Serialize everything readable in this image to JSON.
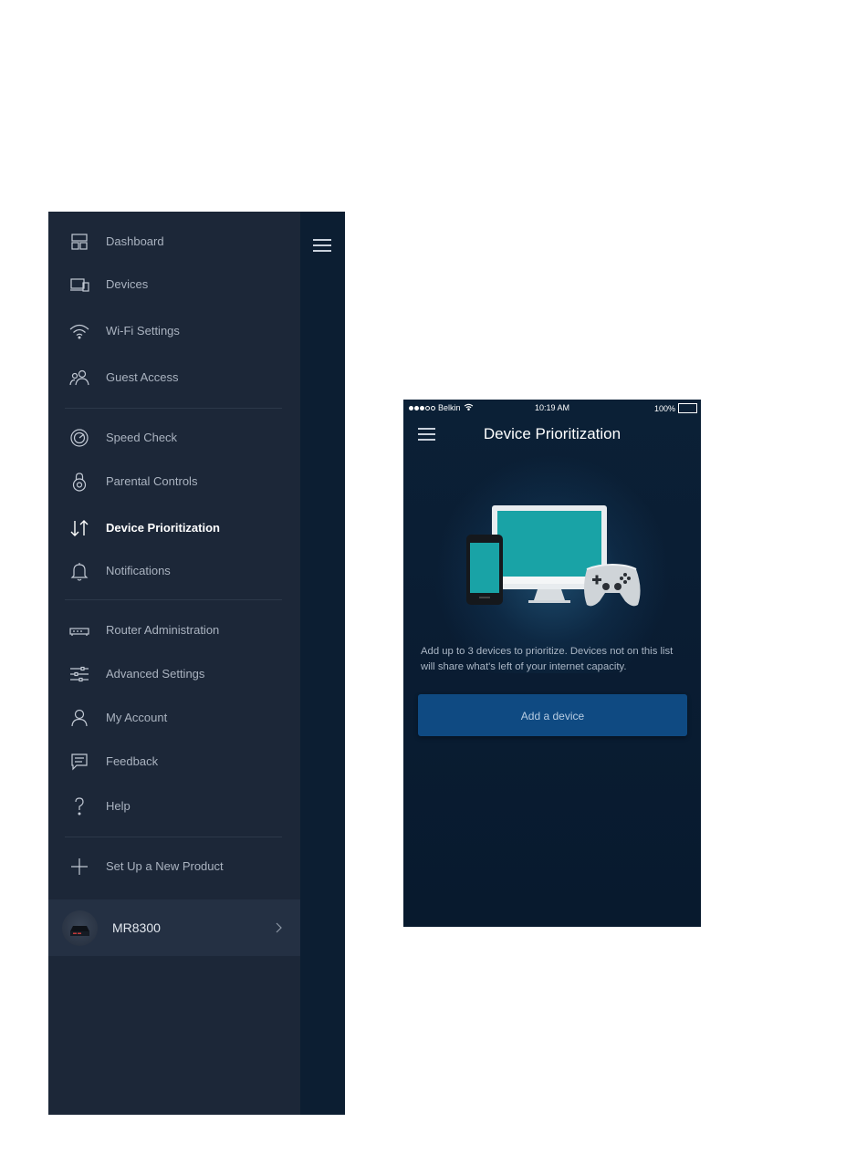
{
  "menu": {
    "items": [
      {
        "label": "Dashboard",
        "icon": "dashboard-icon"
      },
      {
        "label": "Devices",
        "icon": "devices-icon"
      },
      {
        "label": "Wi-Fi Settings",
        "icon": "wifi-icon"
      },
      {
        "label": "Guest Access",
        "icon": "guest-access-icon"
      },
      {
        "label": "Speed Check",
        "icon": "speedometer-icon"
      },
      {
        "label": "Parental Controls",
        "icon": "lock-icon"
      },
      {
        "label": "Device Prioritization",
        "icon": "up-down-arrows-icon",
        "active": true
      },
      {
        "label": "Notifications",
        "icon": "bell-icon"
      },
      {
        "label": "Router Administration",
        "icon": "router-icon"
      },
      {
        "label": "Advanced Settings",
        "icon": "sliders-icon"
      },
      {
        "label": "My Account",
        "icon": "user-icon"
      },
      {
        "label": "Feedback",
        "icon": "chat-icon"
      },
      {
        "label": "Help",
        "icon": "question-icon"
      },
      {
        "label": "Set Up a New Product",
        "icon": "plus-icon"
      }
    ],
    "device": {
      "name": "MR8300"
    }
  },
  "phone": {
    "status_bar": {
      "carrier": "Belkin",
      "time": "10:19 AM",
      "battery": "100%"
    },
    "title": "Device Prioritization",
    "description": "Add up to 3 devices to prioritize. Devices not on this list will share what's left of your internet capacity.",
    "add_button": "Add a device"
  },
  "colors": {
    "drawer_bg": "#1c2738",
    "panel_bg": "#0c1e32",
    "screen_bg": "#0a1d33",
    "button_bg": "#0f4a82",
    "active_text": "#ffffff",
    "inactive_text": "#aab3c0"
  }
}
